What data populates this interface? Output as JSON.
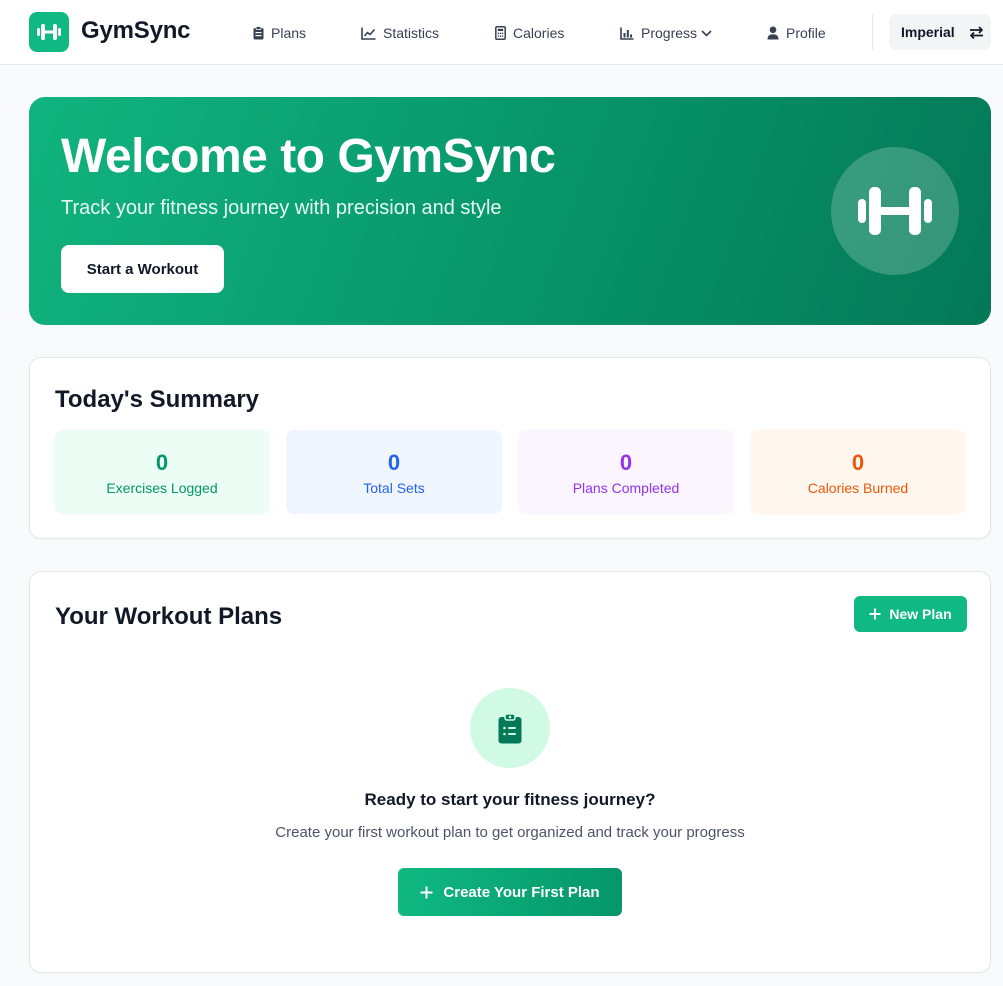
{
  "app": {
    "name": "GymSync"
  },
  "nav": {
    "items": [
      {
        "label": "Plans",
        "icon": "clipboard-icon"
      },
      {
        "label": "Statistics",
        "icon": "chart-line-icon"
      },
      {
        "label": "Calories",
        "icon": "calculator-icon"
      },
      {
        "label": "Progress",
        "icon": "chart-bar-icon"
      },
      {
        "label": "Profile",
        "icon": "user-icon"
      }
    ],
    "unit_toggle": "Imperial"
  },
  "hero": {
    "title": "Welcome to GymSync",
    "subtitle": "Track your fitness journey with precision and style",
    "button": "Start a Workout"
  },
  "summary": {
    "title": "Today's Summary",
    "stats": [
      {
        "value": "0",
        "label": "Exercises Logged",
        "bg": "#ecfdf5",
        "color": "#059669"
      },
      {
        "value": "0",
        "label": "Total Sets",
        "bg": "#eff6ff",
        "color": "#2563eb"
      },
      {
        "value": "0",
        "label": "Plans Completed",
        "bg": "#faf5ff",
        "color": "#9333ea"
      },
      {
        "value": "0",
        "label": "Calories Burned",
        "bg": "#fff7ed",
        "color": "#ea580c"
      }
    ]
  },
  "plans": {
    "title": "Your Workout Plans",
    "new_plan_button": "New Plan",
    "empty_title": "Ready to start your fitness journey?",
    "empty_description": "Create your first workout plan to get organized and track your progress",
    "create_button": "Create Your First Plan"
  },
  "colors": {
    "accent": "#10b981",
    "accent_dark": "#047857"
  }
}
